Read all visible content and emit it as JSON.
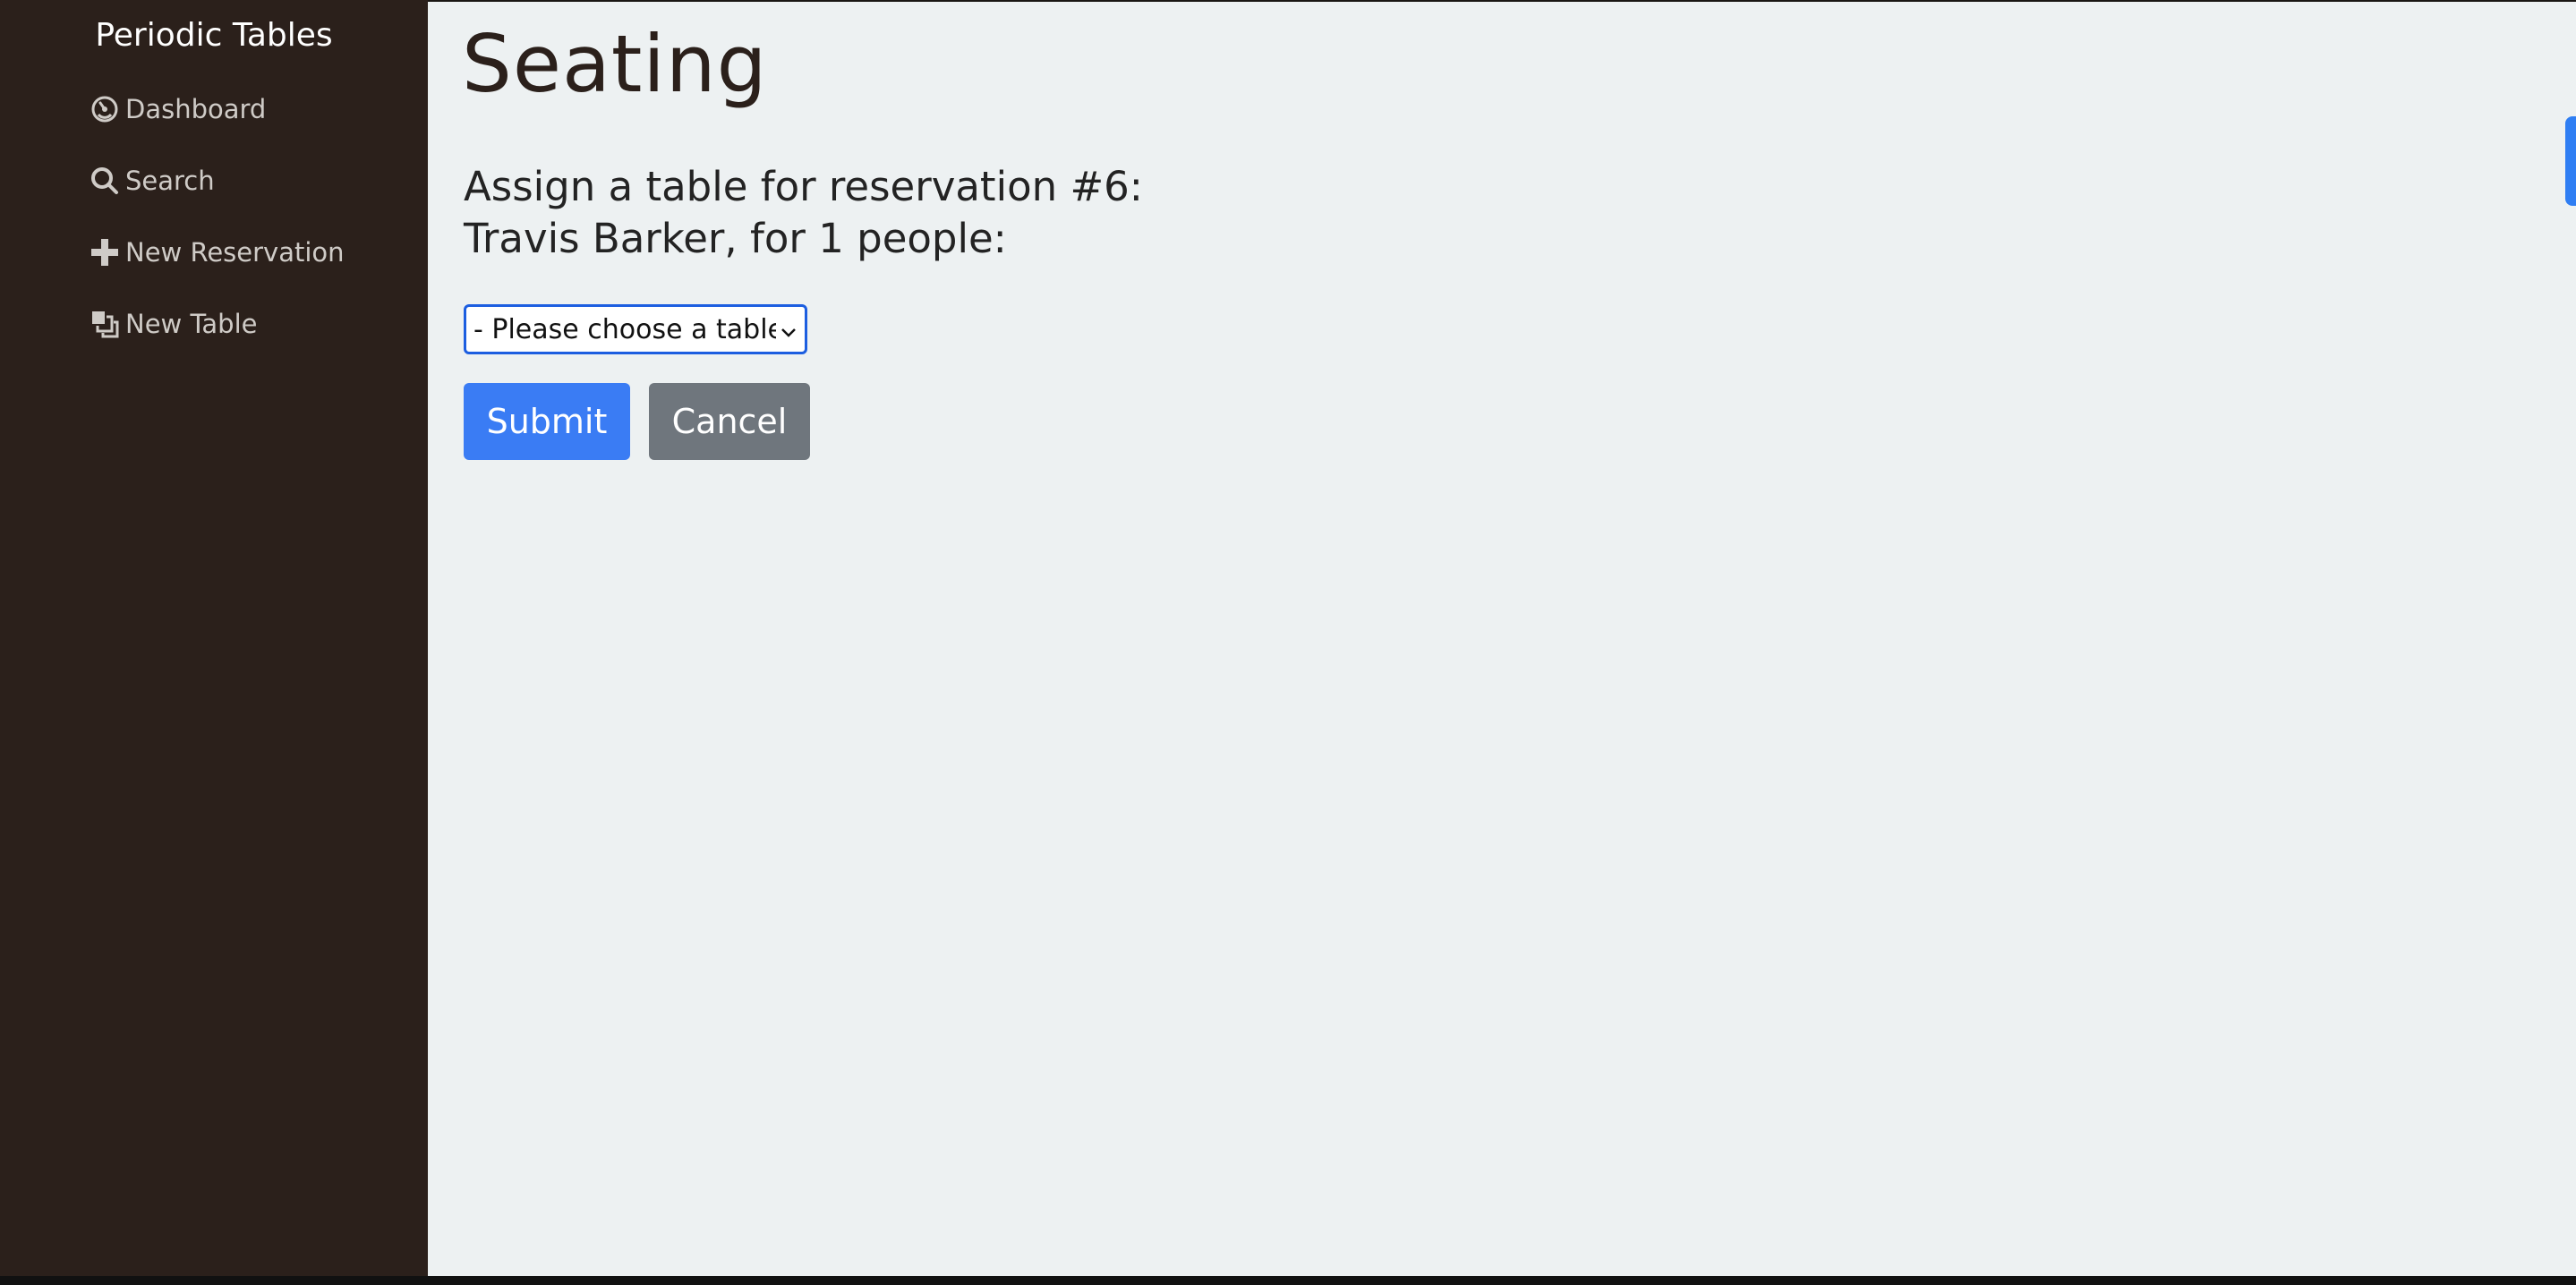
{
  "app": {
    "brand": "Periodic Tables"
  },
  "sidebar": {
    "items": [
      {
        "label": "Dashboard",
        "icon": "dashboard-icon"
      },
      {
        "label": "Search",
        "icon": "search-icon"
      },
      {
        "label": "New Reservation",
        "icon": "plus-icon"
      },
      {
        "label": "New Table",
        "icon": "new-table-icon"
      }
    ]
  },
  "page": {
    "title": "Seating",
    "assign_heading": "Assign a table for reservation #6: Travis Barker, for 1 people:",
    "table_select": {
      "selected": "- Please choose a table -"
    },
    "buttons": {
      "submit": "Submit",
      "cancel": "Cancel"
    }
  },
  "colors": {
    "sidebar_bg": "#2b201b",
    "main_bg": "#edf1f2",
    "primary": "#3a7cf4",
    "secondary": "#6f767d",
    "select_border": "#1c5ee0"
  }
}
